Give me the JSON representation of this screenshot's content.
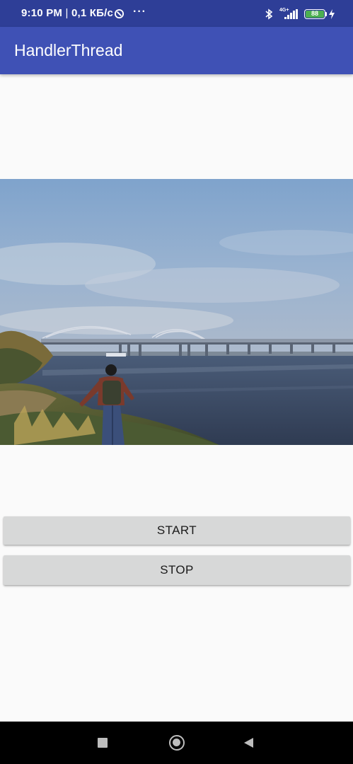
{
  "status_bar": {
    "time": "9:10 PM",
    "separator": " | ",
    "speed": "0,1 КБ/с",
    "more_dots": "···",
    "network_type": "4G+",
    "battery_level": "88",
    "icons": [
      "data-saver-icon",
      "bluetooth-icon",
      "signal-icon",
      "battery-icon",
      "charging-bolt-icon"
    ]
  },
  "app_bar": {
    "title": "HandlerThread"
  },
  "content": {
    "image": "landscape-photo-bridge-river-person",
    "buttons": {
      "start_label": "START",
      "stop_label": "STOP"
    }
  },
  "nav_bar": {
    "icons": [
      "recents-square-icon",
      "home-circle-icon",
      "back-triangle-icon"
    ]
  },
  "colors": {
    "status_bar": "#2e3e97",
    "app_bar": "#3f51b5",
    "background": "#fafafa",
    "button": "#d7d8d8",
    "battery": "#4caf50"
  }
}
